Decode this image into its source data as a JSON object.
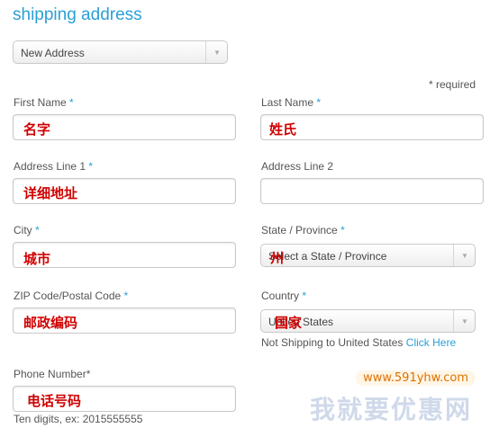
{
  "title": "shipping address",
  "address_select": {
    "value": "New Address"
  },
  "required_note": "* required",
  "fields": {
    "first_name": {
      "label": "First Name",
      "req": "*",
      "overlay": "名字"
    },
    "last_name": {
      "label": "Last Name",
      "req": "*",
      "overlay": "姓氏"
    },
    "address1": {
      "label": "Address Line 1",
      "req": "*",
      "overlay": "详细地址"
    },
    "address2": {
      "label": "Address Line 2",
      "req": ""
    },
    "city": {
      "label": "City",
      "req": "*",
      "overlay": "城市"
    },
    "state": {
      "label": "State / Province",
      "req": "*",
      "value": "Select a State / Province",
      "overlay": "州"
    },
    "zip": {
      "label": "ZIP Code/Postal Code",
      "req": "*",
      "overlay": "邮政编码"
    },
    "country": {
      "label": "Country",
      "req": "*",
      "value": "United States",
      "overlay": "国家"
    },
    "phone": {
      "label": "Phone Number*",
      "overlay": "电话号码",
      "hint": "Ten digits, ex: 2015555555"
    }
  },
  "shipping_note": {
    "text": "Not Shipping to United States",
    "link": "Click Here"
  },
  "watermark": {
    "url": "www.591yhw.com",
    "text": "我就要优惠网"
  }
}
